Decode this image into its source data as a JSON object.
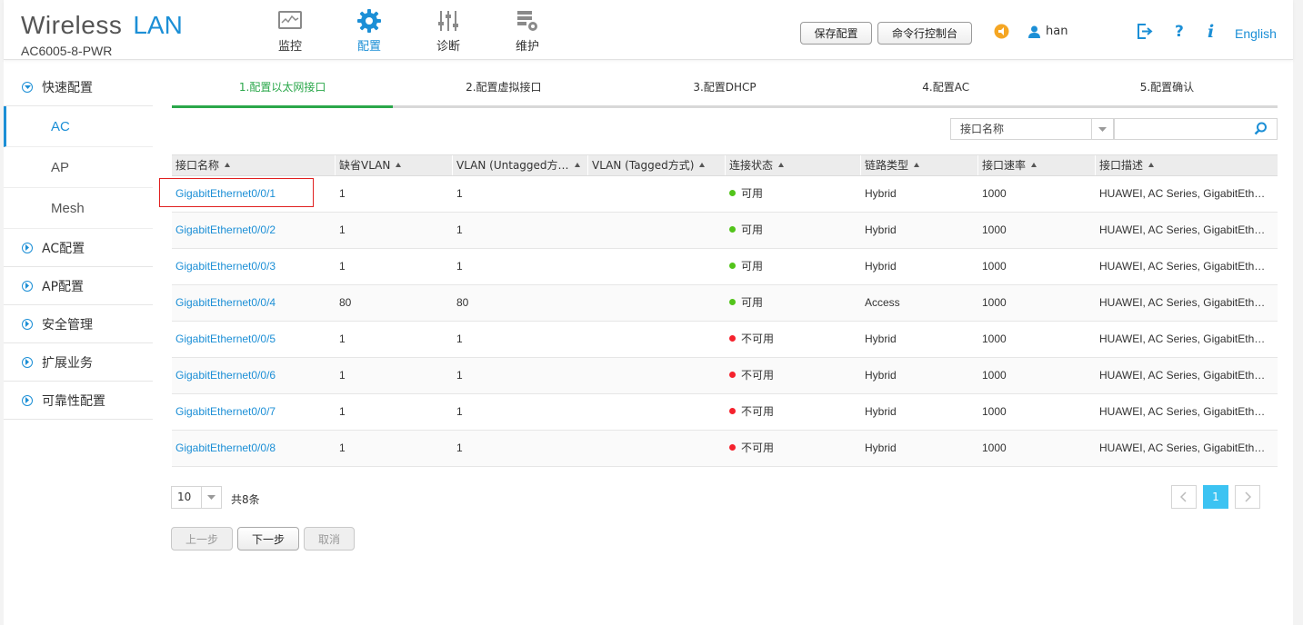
{
  "brand": {
    "title_part1": "Wireless",
    "title_part2": "LAN",
    "model": "AC6005-8-PWR"
  },
  "topnav": [
    {
      "label": "监控",
      "icon": "monitor-icon"
    },
    {
      "label": "配置",
      "icon": "gear-icon",
      "active": true
    },
    {
      "label": "诊断",
      "icon": "sliders-icon"
    },
    {
      "label": "维护",
      "icon": "maintenance-icon"
    }
  ],
  "header": {
    "save_config": "保存配置",
    "cli_console": "命令行控制台",
    "username": "han",
    "language": "English"
  },
  "sidebar": {
    "quick_config": "快速配置",
    "sub_items": [
      "AC",
      "AP",
      "Mesh"
    ],
    "items": [
      "AC配置",
      "AP配置",
      "安全管理",
      "扩展业务",
      "可靠性配置"
    ]
  },
  "steps": [
    "1.配置以太网接口",
    "2.配置虚拟接口",
    "3.配置DHCP",
    "4.配置AC",
    "5.配置确认"
  ],
  "search": {
    "field": "接口名称",
    "value": ""
  },
  "table": {
    "headers": [
      "接口名称",
      "缺省VLAN",
      "VLAN (Untagged方…",
      "VLAN (Tagged方式)",
      "连接状态",
      "链路类型",
      "接口速率",
      "接口描述"
    ],
    "rows": [
      {
        "name": "GigabitEthernet0/0/1",
        "pvid": "1",
        "untagged": "1",
        "tagged": "",
        "status": "可用",
        "up": true,
        "type": "Hybrid",
        "speed": "1000",
        "desc": "HUAWEI, AC Series, GigabitEth…"
      },
      {
        "name": "GigabitEthernet0/0/2",
        "pvid": "1",
        "untagged": "1",
        "tagged": "",
        "status": "可用",
        "up": true,
        "type": "Hybrid",
        "speed": "1000",
        "desc": "HUAWEI, AC Series, GigabitEth…"
      },
      {
        "name": "GigabitEthernet0/0/3",
        "pvid": "1",
        "untagged": "1",
        "tagged": "",
        "status": "可用",
        "up": true,
        "type": "Hybrid",
        "speed": "1000",
        "desc": "HUAWEI, AC Series, GigabitEth…"
      },
      {
        "name": "GigabitEthernet0/0/4",
        "pvid": "80",
        "untagged": "80",
        "tagged": "",
        "status": "可用",
        "up": true,
        "type": "Access",
        "speed": "1000",
        "desc": "HUAWEI, AC Series, GigabitEth…"
      },
      {
        "name": "GigabitEthernet0/0/5",
        "pvid": "1",
        "untagged": "1",
        "tagged": "",
        "status": "不可用",
        "up": false,
        "type": "Hybrid",
        "speed": "1000",
        "desc": "HUAWEI, AC Series, GigabitEth…"
      },
      {
        "name": "GigabitEthernet0/0/6",
        "pvid": "1",
        "untagged": "1",
        "tagged": "",
        "status": "不可用",
        "up": false,
        "type": "Hybrid",
        "speed": "1000",
        "desc": "HUAWEI, AC Series, GigabitEth…"
      },
      {
        "name": "GigabitEthernet0/0/7",
        "pvid": "1",
        "untagged": "1",
        "tagged": "",
        "status": "不可用",
        "up": false,
        "type": "Hybrid",
        "speed": "1000",
        "desc": "HUAWEI, AC Series, GigabitEth…"
      },
      {
        "name": "GigabitEthernet0/0/8",
        "pvid": "1",
        "untagged": "1",
        "tagged": "",
        "status": "不可用",
        "up": false,
        "type": "Hybrid",
        "speed": "1000",
        "desc": "HUAWEI, AC Series, GigabitEth…"
      }
    ]
  },
  "pager": {
    "page_size": "10",
    "total": "共8条",
    "current_page": "1"
  },
  "buttons": {
    "prev": "上一步",
    "next": "下一步",
    "cancel": "取消"
  },
  "colors": {
    "accent": "#1c8fd6",
    "ok": "#52c41a",
    "bad": "#f5222d",
    "step_active": "#2aa74a",
    "page_active": "#3cc3f2"
  }
}
